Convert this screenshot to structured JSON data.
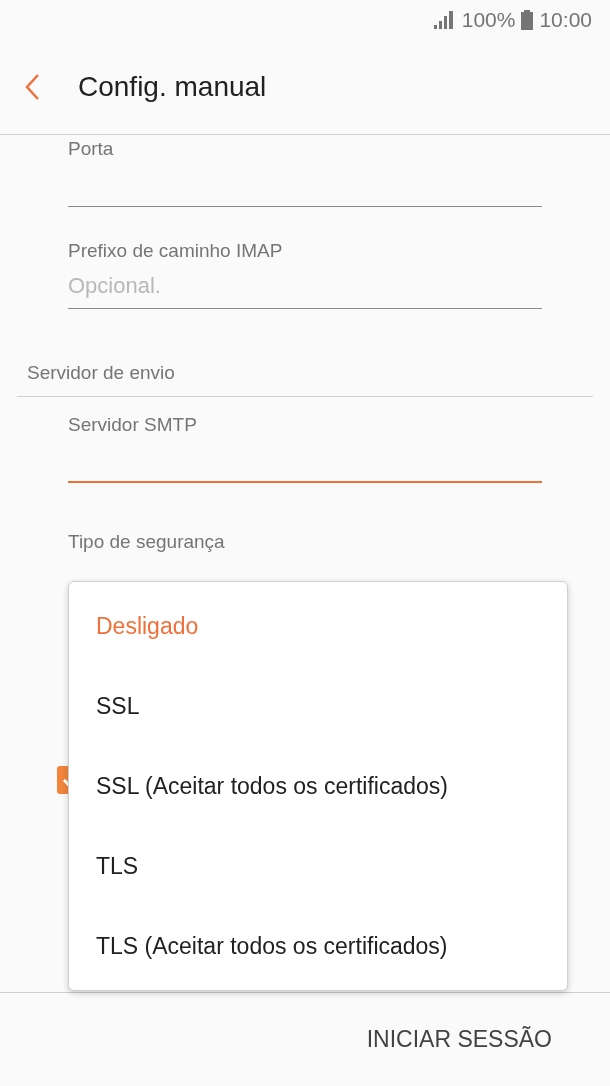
{
  "status_bar": {
    "battery": "100%",
    "time": "10:00"
  },
  "header": {
    "title": "Config. manual"
  },
  "fields": [
    {
      "label": "Porta",
      "focused": false
    },
    {
      "label": "Prefixo de caminho IMAP",
      "placeholder": "Opcional.",
      "focused": false
    }
  ],
  "section": {
    "title": "Servidor de envio"
  },
  "smtp_field": {
    "label": "Servidor SMTP",
    "focused": true
  },
  "security": {
    "label": "Tipo de segurança"
  },
  "checkbox": {
    "checked": true
  },
  "dropdown": {
    "options": [
      {
        "label": "Desligado",
        "selected": true
      },
      {
        "label": "SSL",
        "selected": false
      },
      {
        "label": "SSL (Aceitar todos os certificados)",
        "selected": false
      },
      {
        "label": "TLS",
        "selected": false
      },
      {
        "label": "TLS (Aceitar todos os certificados)",
        "selected": false
      }
    ]
  },
  "footer": {
    "button": "INICIAR SESSÃO"
  }
}
